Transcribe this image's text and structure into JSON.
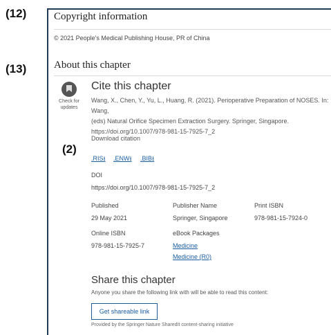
{
  "callouts": {
    "c12": "(12)",
    "c13": "(13)",
    "c2": "(2)"
  },
  "copyright": {
    "heading": "Copyright information",
    "text": "© 2021 People's Medical Publishing House, PR of China"
  },
  "about": {
    "heading": "About this chapter"
  },
  "badge": {
    "line1": "Check for",
    "line2": "updates"
  },
  "cite": {
    "title": "Cite this chapter",
    "line1": "Wang, X., Chen, Y., Yu, L., Huang, R. (2021). Perioperative Preparation of NOSES. In: Wang,",
    "line2": "(eds) Natural Orifice Specimen Extraction Surgery. Springer, Singapore.",
    "line3": "https://doi.org/10.1007/978-981-15-7925-7_2"
  },
  "download": {
    "label": "Download citation",
    "ris": ".RIS⭳",
    "enw": ".ENW⭳",
    "bib": ".BIB⭳"
  },
  "doi": {
    "label": "DOI",
    "value": "https://doi.org/10.1007/978-981-15-7925-7_2"
  },
  "meta": {
    "published_label": "Published",
    "published_value": "29 May 2021",
    "publisher_label": "Publisher Name",
    "publisher_value": "Springer, Singapore",
    "print_isbn_label": "Print ISBN",
    "print_isbn_value": "978-981-15-7924-0",
    "online_isbn_label": "Online ISBN",
    "online_isbn_value": "978-981-15-7925-7",
    "ebook_label": "eBook Packages",
    "ebook1": "Medicine",
    "ebook2": "Medicine (R0)"
  },
  "share": {
    "title": "Share this chapter",
    "text": "Anyone you share the following link with will be able to read this content:",
    "button": "Get shareable link",
    "footer": "Provided by the Springer Nature SharedIt content-sharing initiative"
  },
  "colors": {
    "panel_border": "#1f3a55",
    "link": "#1a5c9e"
  }
}
